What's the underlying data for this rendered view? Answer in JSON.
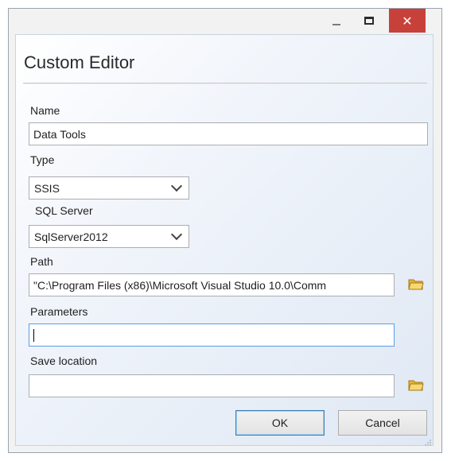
{
  "window": {
    "controls": {
      "minimize": "minimize",
      "maximize": "maximize",
      "close": "✕"
    }
  },
  "dialog": {
    "title": "Custom Editor",
    "name": {
      "label": "Name",
      "value": "Data Tools"
    },
    "type": {
      "label": "Type",
      "selected": "SSIS"
    },
    "sql_server": {
      "label": "SQL Server",
      "selected": "SqlServer2012"
    },
    "path": {
      "label": "Path",
      "value": "\"C:\\Program Files (x86)\\Microsoft Visual Studio 10.0\\Comm"
    },
    "parameters": {
      "label": "Parameters",
      "value": ""
    },
    "save_location": {
      "label": "Save location",
      "value": ""
    },
    "ok_label": "OK",
    "cancel_label": "Cancel"
  },
  "icons": {
    "folder": "folder-icon",
    "dropdown": "chevron-down-icon"
  },
  "colors": {
    "close_button": "#c7413a",
    "focus_border": "#569de5",
    "default_button_border": "#3c7fb1"
  }
}
